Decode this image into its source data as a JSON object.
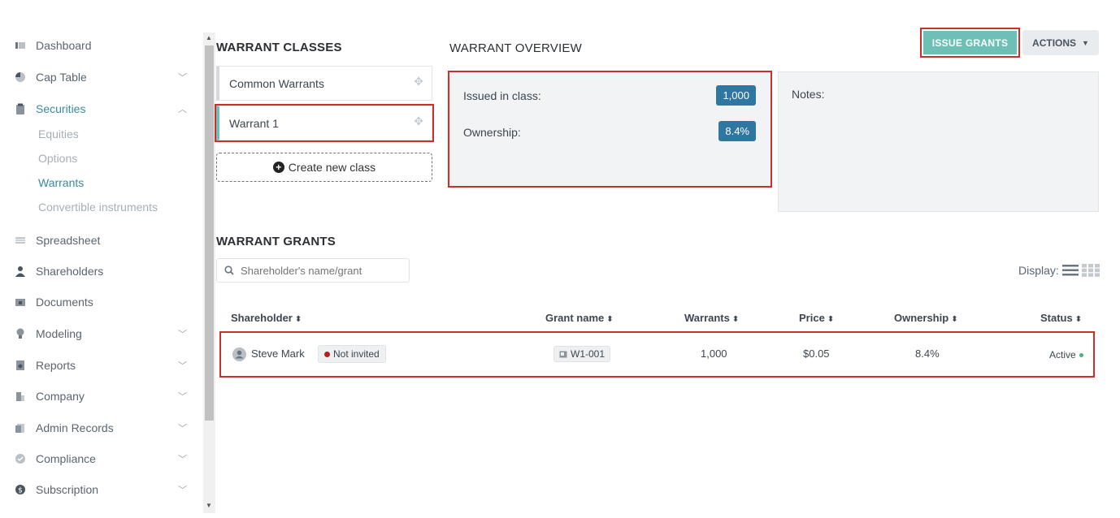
{
  "sidebar": {
    "items": [
      {
        "label": "Dashboard",
        "icon": "dashboard-icon"
      },
      {
        "label": "Cap Table",
        "icon": "pie-chart-icon"
      },
      {
        "label": "Securities",
        "icon": "clipboard-icon"
      },
      {
        "label": "Spreadsheet",
        "icon": "spreadsheet-icon"
      },
      {
        "label": "Shareholders",
        "icon": "person-icon"
      },
      {
        "label": "Documents",
        "icon": "folder-icon"
      },
      {
        "label": "Modeling",
        "icon": "lightbulb-icon"
      },
      {
        "label": "Reports",
        "icon": "reports-icon"
      },
      {
        "label": "Company",
        "icon": "building-icon"
      },
      {
        "label": "Admin Records",
        "icon": "records-icon"
      },
      {
        "label": "Compliance",
        "icon": "shield-check-icon"
      },
      {
        "label": "Subscription",
        "icon": "dollar-circle-icon"
      }
    ],
    "securities_sub": [
      "Equities",
      "Options",
      "Warrants",
      "Convertible instruments"
    ]
  },
  "classes": {
    "title": "WARRANT CLASSES",
    "items": [
      "Common Warrants",
      "Warrant 1"
    ],
    "create_label": "Create new class"
  },
  "overview": {
    "title": "WARRANT OVERVIEW",
    "issued_label": "Issued in class:",
    "issued_value": "1,000",
    "ownership_label": "Ownership:",
    "ownership_value": "8.4%",
    "notes_label": "Notes:"
  },
  "toolbar": {
    "issue_label": "ISSUE GRANTS",
    "actions_label": "ACTIONS"
  },
  "grants": {
    "title": "WARRANT GRANTS",
    "search_placeholder": "Shareholder's name/grant",
    "display_label": "Display:",
    "columns": [
      "Shareholder",
      "Grant name",
      "Warrants",
      "Price",
      "Ownership",
      "Status"
    ],
    "rows": [
      {
        "shareholder": "Steve Mark",
        "invite_status": "Not invited",
        "grant_name": "W1-001",
        "warrants": "1,000",
        "price": "$0.05",
        "ownership": "8.4%",
        "status": "Active"
      }
    ]
  },
  "colors": {
    "accent": "#6cc0b5",
    "badge_blue": "#2f77a0",
    "highlight_red": "#c9302c",
    "active_link": "#3a8a9c"
  }
}
